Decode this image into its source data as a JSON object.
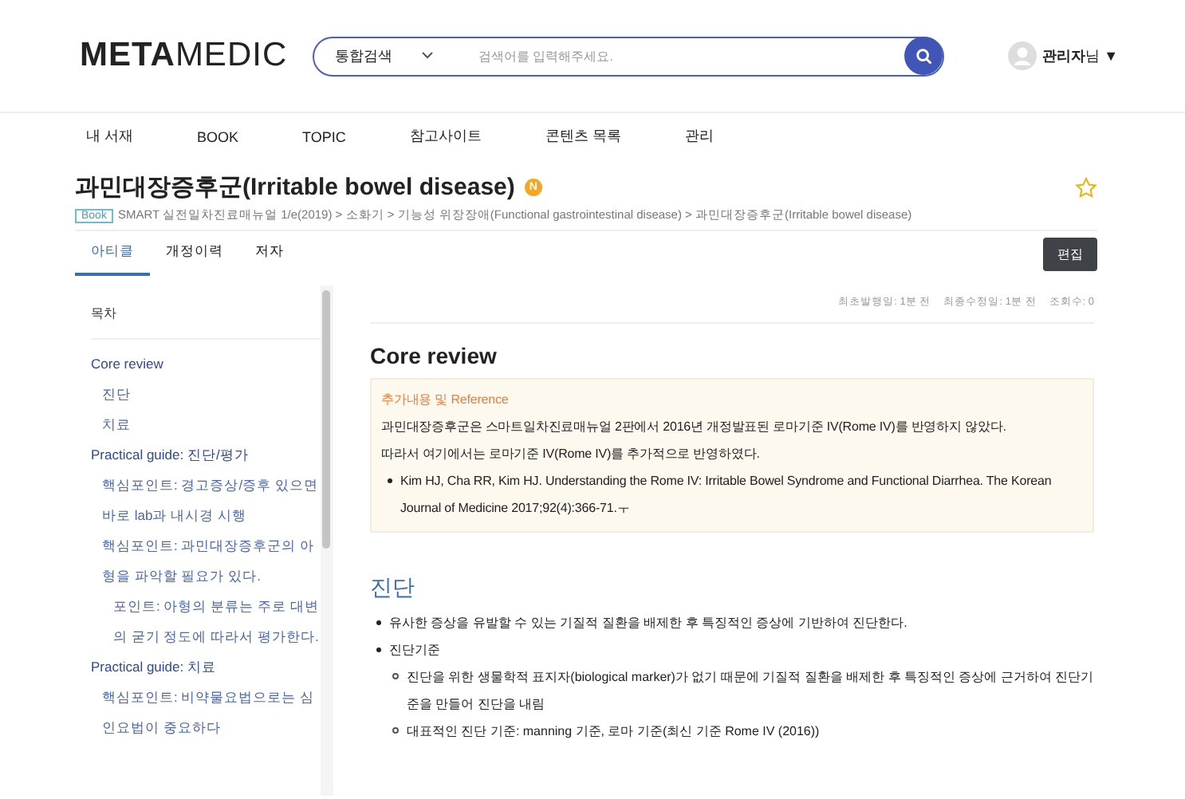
{
  "header": {
    "logo": {
      "bold": "META",
      "light": "MEDIC"
    },
    "search": {
      "scope": "통합검색",
      "placeholder": "검색어를 입력해주세요."
    },
    "user": {
      "name": "관리자",
      "suffix": "님",
      "caret": "▼"
    }
  },
  "nav": [
    "내 서재",
    "BOOK",
    "TOPIC",
    "참고사이트",
    "콘텐츠 목록",
    "관리"
  ],
  "title": {
    "text": "과민대장증후군(Irritable bowel disease)",
    "badge": "N",
    "starred": false
  },
  "breadcrumb": {
    "tag": "Book",
    "path": "SMART 실전일차진료매뉴얼 1/e(2019) > 소화기 > 기능성 위장장애(Functional gastrointestinal disease) > 과민대장증후군(Irritable bowel disease)"
  },
  "tabs": [
    {
      "label": "아티클",
      "selected": true
    },
    {
      "label": "개정이력",
      "selected": false
    },
    {
      "label": "저자",
      "selected": false
    }
  ],
  "edit_button": "편집",
  "toc": {
    "title": "목차",
    "items": [
      {
        "label": "Core review",
        "children": [
          {
            "label": "진단"
          },
          {
            "label": "치료"
          }
        ]
      },
      {
        "label": "Practical guide: 진단/평가",
        "children": [
          {
            "label": "핵심포인트: 경고증상/증후 있으면 바로 lab과 내시경 시행"
          },
          {
            "label": "핵심포인트: 과민대장증후군의 아형을 파악할 필요가 있다.",
            "children": [
              {
                "label": "포인트: 아형의 분류는 주로 대변의 굳기 정도에 따라서 평가한다."
              }
            ]
          }
        ]
      },
      {
        "label": "Practical guide: 치료",
        "children": [
          {
            "label": "핵심포인트: 비약물요법으로는 심인요법이 중요하다"
          }
        ]
      }
    ]
  },
  "meta": [
    "최초발행일: 1분 전",
    "최종수정일: 1분 전",
    "조회수: 0"
  ],
  "article": {
    "heading": "Core review",
    "note": {
      "title": "추가내용 및 Reference",
      "lines": [
        "과민대장증후군은 스마트일차진료매뉴얼 2판에서 2016년 개정발표된 로마기준 IV(Rome IV)를 반영하지 않았다.",
        "따라서 여기에서는 로마기준 IV(Rome IV)를 추가적으로 반영하였다."
      ],
      "refs": [
        "Kim HJ, Cha RR, Kim HJ. Understanding the Rome IV: Irritable Bowel Syndrome and Functional Diarrhea. The Korean Journal of Medicine 2017;92(4):366-71.ㅜ"
      ]
    },
    "section": {
      "heading": "진단",
      "bullets": [
        {
          "text": "유사한 증상을 유발할 수 있는 기질적 질환을 배제한 후 특징적인 증상에 기반하여 진단한다."
        },
        {
          "text": "진단기준",
          "children": [
            {
              "text": "진단을 위한 생물학적 표지자(biological marker)가 없기 때문에 기질적 질환을 배제한 후 특징적인 증상에 근거하여 진단기준을 만들어 진단을 내림"
            },
            {
              "text": "대표적인 진단 기준: manning 기준, 로마 기준(최신 기준 Rome IV (2016))"
            }
          ]
        }
      ]
    }
  }
}
